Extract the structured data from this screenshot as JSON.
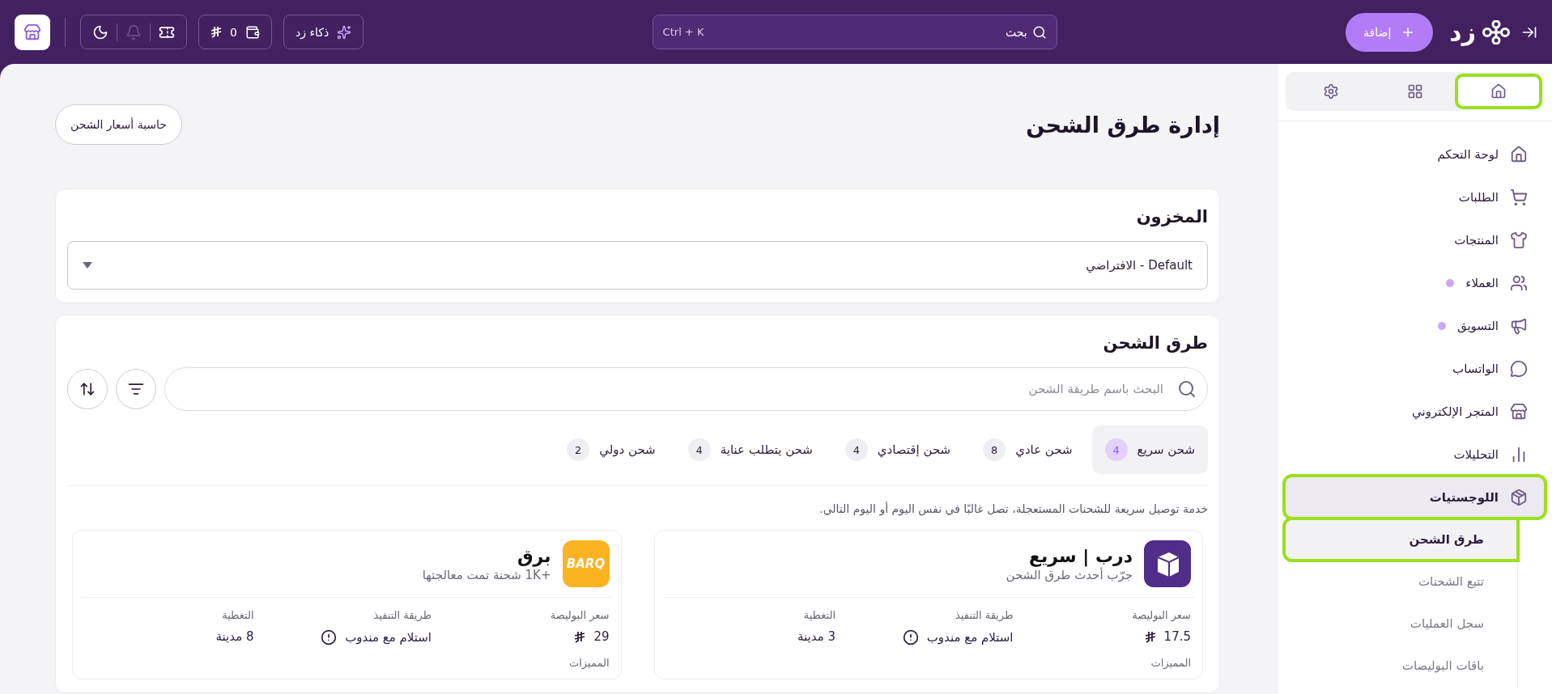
{
  "topbar": {
    "logo_text": "زد",
    "add_button": "إضافة",
    "search": {
      "placeholder": "بحث",
      "shortcut": "Ctrl + K"
    },
    "ai_button": "ذكاء زد",
    "wallet_amount": "0",
    "notifications_disabled": true
  },
  "sidebar": {
    "tabs": [
      {
        "selected": true,
        "highlighted": true
      },
      {
        "selected": false,
        "highlighted": false
      },
      {
        "selected": false,
        "highlighted": false
      }
    ],
    "items": [
      {
        "label": "لوحة التحكم",
        "dot": false,
        "selected": false,
        "highlighted": false
      },
      {
        "label": "الطلبات",
        "dot": false,
        "selected": false,
        "highlighted": false
      },
      {
        "label": "المنتجات",
        "dot": false,
        "selected": false,
        "highlighted": false
      },
      {
        "label": "العملاء",
        "dot": true,
        "selected": false,
        "highlighted": false
      },
      {
        "label": "التسويق",
        "dot": true,
        "selected": false,
        "highlighted": false
      },
      {
        "label": "الواتساب",
        "dot": false,
        "selected": false,
        "highlighted": false
      },
      {
        "label": "المتجر الإلكتروني",
        "dot": false,
        "selected": false,
        "highlighted": false
      },
      {
        "label": "التحليلات",
        "dot": false,
        "selected": false,
        "highlighted": false
      },
      {
        "label": "اللوجستيات",
        "dot": false,
        "selected": true,
        "highlighted": true,
        "children": [
          {
            "label": "طرق الشحن",
            "selected": true,
            "highlighted": true
          },
          {
            "label": "تتبع الشحنات",
            "selected": false,
            "highlighted": false
          },
          {
            "label": "سجل العمليات",
            "selected": false,
            "highlighted": false
          },
          {
            "label": "باقات البوليصات",
            "selected": false,
            "highlighted": false
          }
        ]
      }
    ]
  },
  "page": {
    "title": "إدارة طرق الشحن",
    "calculator_button": "حاسبة أسعار الشحن",
    "warehouse": {
      "title": "المخزون",
      "value": "Default - الافتراضي"
    },
    "methods": {
      "title": "طرق الشحن",
      "search_placeholder": "البحث باسم طريقة الشحن",
      "tabs": [
        {
          "label": "شحن سريع",
          "count": "4",
          "selected": true
        },
        {
          "label": "شحن عادي",
          "count": "8",
          "selected": false
        },
        {
          "label": "شحن إقتصادي",
          "count": "4",
          "selected": false
        },
        {
          "label": "شحن يتطلب عناية",
          "count": "4",
          "selected": false
        },
        {
          "label": "شحن دولي",
          "count": "2",
          "selected": false
        }
      ],
      "description": "خدمة توصيل سريعة للشحنات المستعجلة، تصل غالبًا في نفس اليوم أو اليوم التالي.",
      "cards": [
        {
          "name": "درب | سريع",
          "subtitle": "جرّب أحدث طرق الشحن",
          "logo": {
            "kind": "box"
          },
          "fields": [
            {
              "kind": "price",
              "label": "سعر البوليصة",
              "value": "17.5"
            },
            {
              "kind": "method",
              "label": "طريقة التنفيذ",
              "value": "استلام مع مندوب"
            },
            {
              "kind": "text",
              "label": "التغطية",
              "value": "3 مدينة"
            }
          ],
          "features_label": "المميزات"
        },
        {
          "name": "برق",
          "subtitle": "+1K شحنة تمت معالجتها",
          "logo": {
            "kind": "text",
            "text": "BARQ"
          },
          "fields": [
            {
              "kind": "price",
              "label": "سعر البوليصة",
              "value": "29"
            },
            {
              "kind": "method",
              "label": "طريقة التنفيذ",
              "value": "استلام مع مندوب"
            },
            {
              "kind": "text",
              "label": "التغطية",
              "value": "8 مدينة"
            }
          ],
          "features_label": "المميزات"
        }
      ]
    }
  }
}
